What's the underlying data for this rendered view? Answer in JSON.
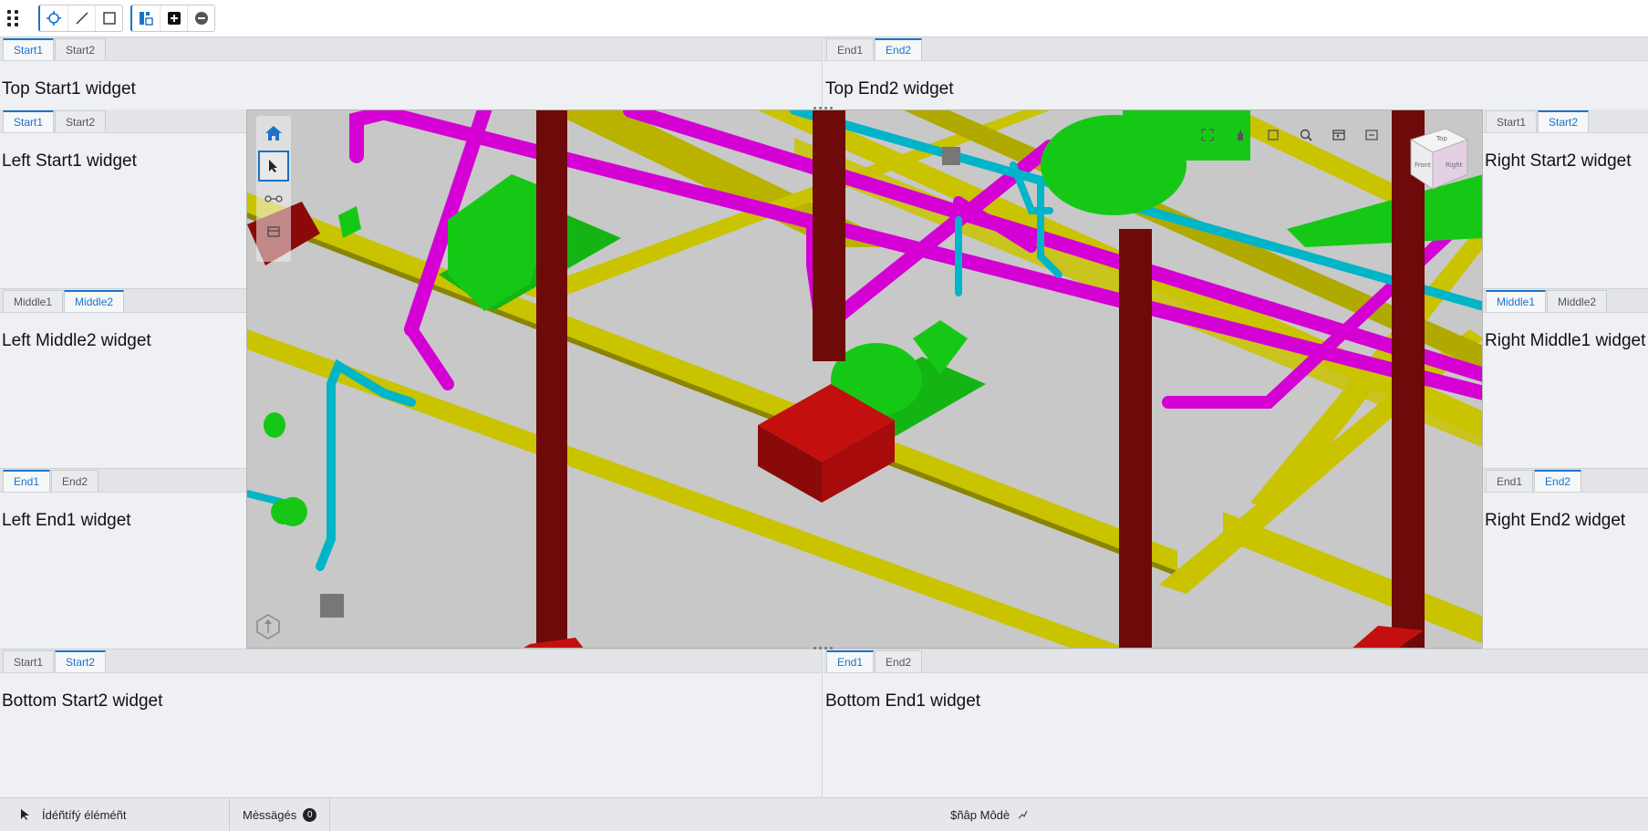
{
  "toolbar": {
    "buttons": [
      "grip-icon",
      "select-tool-icon",
      "line-tool-icon",
      "rectangle-tool-icon",
      "layout-tool-icon",
      "add-icon",
      "remove-icon"
    ]
  },
  "top_start": {
    "tabs": [
      "Start1",
      "Start2"
    ],
    "active": 0,
    "text": "Top Start1 widget"
  },
  "top_end": {
    "tabs": [
      "End1",
      "End2"
    ],
    "active": 1,
    "text": "Top End2 widget"
  },
  "left_start": {
    "tabs": [
      "Start1",
      "Start2"
    ],
    "active": 0,
    "text": "Left Start1 widget"
  },
  "left_middle": {
    "tabs": [
      "Middle1",
      "Middle2"
    ],
    "active": 1,
    "text": "Left Middle2 widget"
  },
  "left_end": {
    "tabs": [
      "End1",
      "End2"
    ],
    "active": 0,
    "text": "Left End1 widget"
  },
  "right_start": {
    "tabs": [
      "Start1",
      "Start2"
    ],
    "active": 1,
    "text": "Right Start2 widget"
  },
  "right_middle": {
    "tabs": [
      "Middle1",
      "Middle2"
    ],
    "active": 0,
    "text": "Right Middle1 widget"
  },
  "right_end": {
    "tabs": [
      "End1",
      "End2"
    ],
    "active": 1,
    "text": "Right End2 widget"
  },
  "bottom_start": {
    "tabs": [
      "Start1",
      "Start2"
    ],
    "active": 1,
    "text": "Bottom Start2 widget"
  },
  "bottom_end": {
    "tabs": [
      "End1",
      "End2"
    ],
    "active": 0,
    "text": "Bottom End1 widget"
  },
  "viewport": {
    "nav_icons": [
      "home-icon",
      "select-arrow-icon",
      "walk-icon",
      "section-box-icon"
    ],
    "tool_icons": [
      "fit-icon",
      "pan-icon",
      "frame-icon",
      "zoom-icon",
      "window-icon",
      "collapse-icon"
    ],
    "cube_faces": [
      "Top",
      "Front",
      "Right"
    ],
    "colors": {
      "background": "#c8c8c8",
      "pipe_magenta": "#d400d4",
      "pipe_cyan": "#00b5c8",
      "beam_yellow": "#c9c300",
      "column_red": "#6e0a0a",
      "equipment_green": "#14c814",
      "base_red": "#c40f0f"
    }
  },
  "status": {
    "tool": "Ídéñtífý éléméñt",
    "messages_label": "Mèssägés",
    "messages_count": "0",
    "snap_label": "$ñâp Môdè"
  },
  "accent": "#1a73c9"
}
